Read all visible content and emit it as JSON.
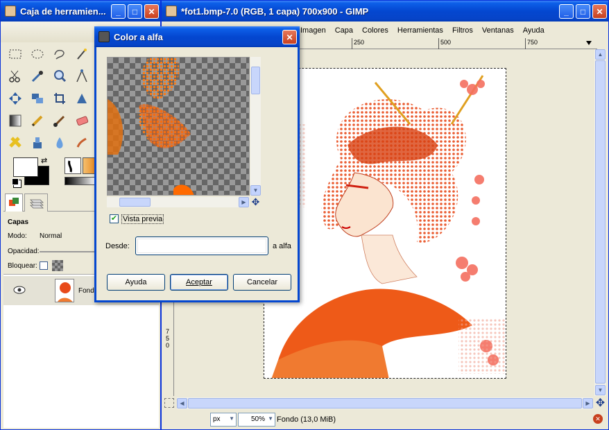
{
  "toolbox": {
    "title": "Caja de herramien...",
    "layers_heading": "Capas",
    "mode_label": "Modo:",
    "mode_value": "Normal",
    "opacity_label": "Opacidad:",
    "lock_label": "Bloquear:",
    "layer_name": "Fondo"
  },
  "gimp_window": {
    "title": "*fot1.bmp-7.0 (RGB, 1 capa) 700x900 - GIMP",
    "menu": [
      "Imagen",
      "Capa",
      "Colores",
      "Herramientas",
      "Filtros",
      "Ventanas",
      "Ayuda"
    ],
    "ruler_h": [
      "250",
      "500",
      "750"
    ],
    "ruler_v": [
      "7",
      "5",
      "0"
    ],
    "unit": "px",
    "zoom": "50%",
    "status": "Fondo (13,0 MiB)"
  },
  "dialog": {
    "title": "Color a alfa",
    "preview_label": "Vista previa",
    "preview_checked": true,
    "from_label": "Desde:",
    "to_label": "a alfa",
    "from_value": "",
    "buttons": {
      "help": "Ayuda",
      "ok": "Aceptar",
      "cancel": "Cancelar"
    }
  },
  "colors": {
    "xp_blue": "#0447d0",
    "accent_orange": "#e8501a",
    "panel": "#ece9d8"
  },
  "icons": [
    "close-icon",
    "minimize-icon",
    "maximize-icon",
    "eye-icon",
    "navigate-icon",
    "check-icon"
  ]
}
